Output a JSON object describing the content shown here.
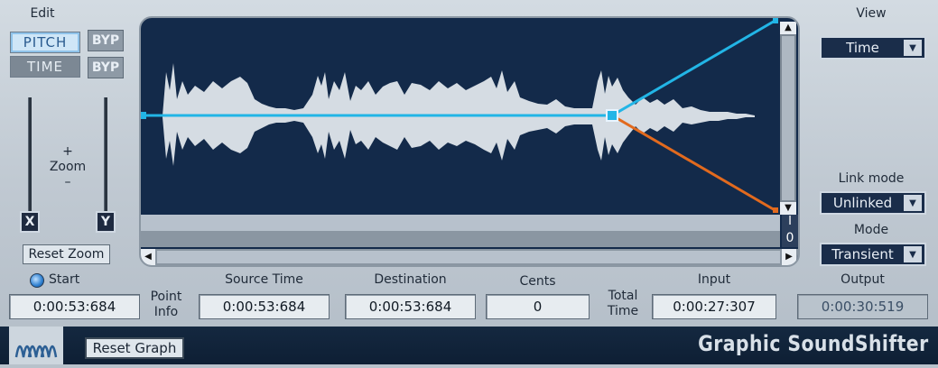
{
  "edit": {
    "title": "Edit",
    "pitch_label": "PITCH",
    "time_label": "TIME",
    "byp1_label": "BYP",
    "byp2_label": "BYP",
    "zoom_plus": "+",
    "zoom_label": "Zoom",
    "zoom_minus": "–",
    "x_thumb": "X",
    "y_thumb": "Y",
    "reset_zoom_label": "Reset Zoom"
  },
  "view": {
    "title": "View",
    "value": "Time"
  },
  "link_mode": {
    "title": "Link mode",
    "value": "Unlinked"
  },
  "mode": {
    "title": "Mode",
    "value": "Transient"
  },
  "display": {
    "readout_top": "I",
    "readout_bottom": "0"
  },
  "readouts": {
    "start_label": "Start",
    "start_value": "0:00:53:684",
    "point_info_label_1": "Point",
    "point_info_label_2": "Info",
    "source_time_label": "Source Time",
    "source_time_value": "0:00:53:684",
    "destination_label": "Destination",
    "destination_value": "0:00:53:684",
    "cents_label": "Cents",
    "cents_value": "0",
    "total_time_label_1": "Total",
    "total_time_label_2": "Time",
    "input_label": "Input",
    "input_value": "0:00:27:307",
    "output_label": "Output",
    "output_value": "0:00:30:519"
  },
  "footer": {
    "reset_graph_label": "Reset Graph",
    "brand": "Graphic SoundShifter"
  },
  "colors": {
    "accent_line": "#22b5e6",
    "secondary_line": "#e26a1e",
    "display_bg": "#132a4a"
  }
}
